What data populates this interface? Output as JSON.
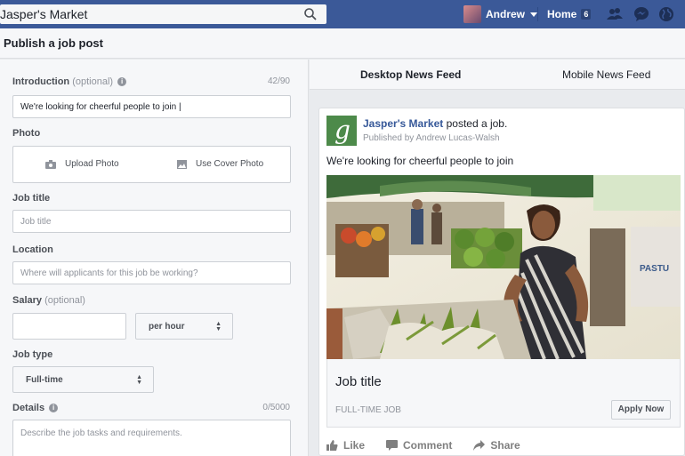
{
  "topbar": {
    "search_value": "Jasper's Market",
    "user_name": "Andrew",
    "home_label": "Home",
    "home_count": "6"
  },
  "modal": {
    "title": "Publish a job post"
  },
  "form": {
    "intro": {
      "label": "Introduction",
      "optional": "(optional)",
      "counter": "42/90",
      "value": "We're looking for cheerful people to join"
    },
    "photo": {
      "label": "Photo",
      "upload": "Upload Photo",
      "cover": "Use Cover Photo"
    },
    "job_title": {
      "label": "Job title",
      "placeholder": "Job title"
    },
    "location": {
      "label": "Location",
      "placeholder": "Where will applicants for this job be working?"
    },
    "salary": {
      "label": "Salary",
      "optional": "(optional)",
      "period": "per hour"
    },
    "job_type": {
      "label": "Job type",
      "value": "Full-time"
    },
    "details": {
      "label": "Details",
      "counter": "0/5000",
      "placeholder": "Describe the job tasks and requirements."
    }
  },
  "preview": {
    "tabs": [
      "Desktop News Feed",
      "Mobile News Feed"
    ],
    "page_name": "Jasper's Market",
    "action_text": "posted a job.",
    "published_by": "Published by Andrew Lucas-Walsh",
    "post_text": "We're looking for cheerful people to join",
    "job_title": "Job title",
    "job_type": "FULL-TIME JOB",
    "apply_label": "Apply Now",
    "actions": [
      "Like",
      "Comment",
      "Share"
    ],
    "logo_letter": "g"
  },
  "colors": {
    "brand": "#3b5998",
    "link": "#365899",
    "logo_green": "#4d8a4a"
  }
}
